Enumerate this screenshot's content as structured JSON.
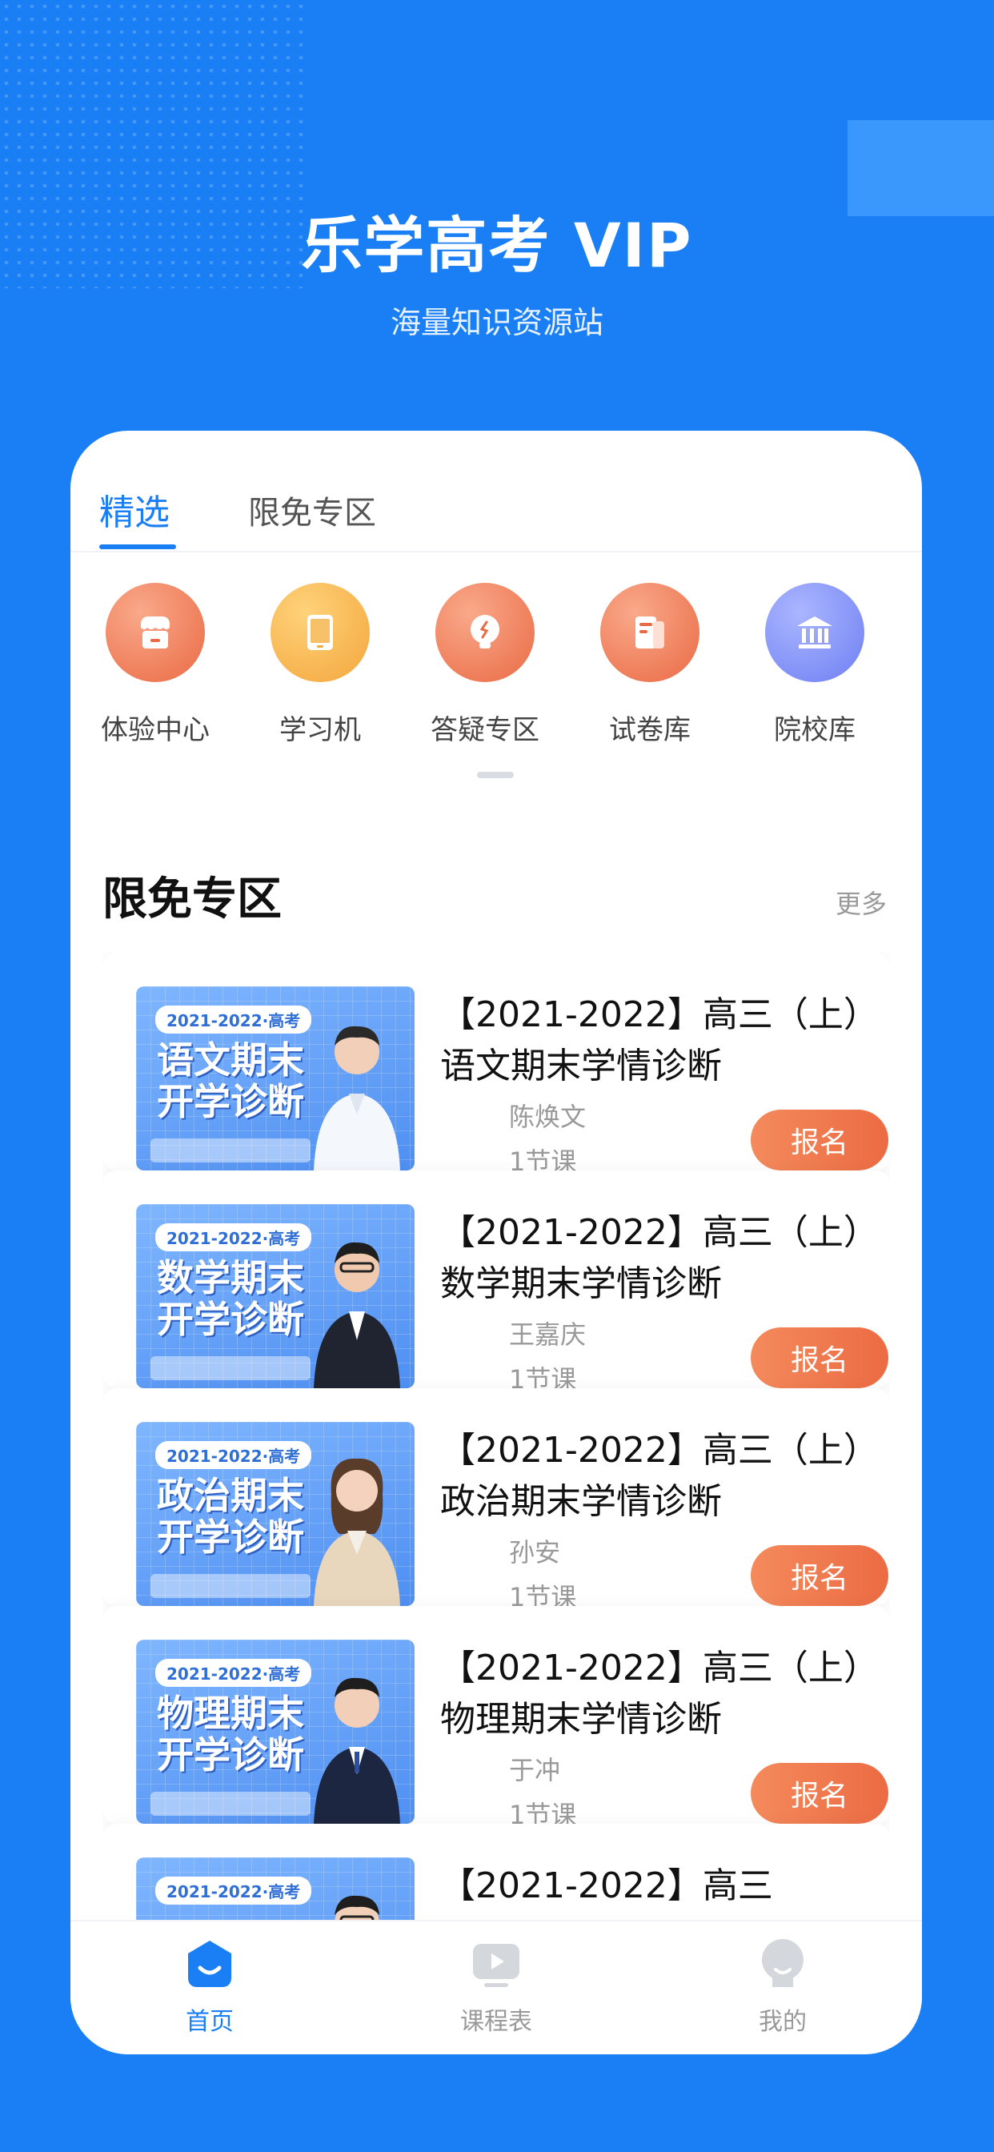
{
  "header": {
    "title": "乐学高考 VIP",
    "subtitle": "海量知识资源站"
  },
  "tabs": [
    {
      "label": "精选",
      "active": true
    },
    {
      "label": "限免专区",
      "active": false
    }
  ],
  "categories": [
    {
      "label": "体验中心",
      "icon": "shop-icon",
      "color": "#f07a5a"
    },
    {
      "label": "学习机",
      "icon": "tablet-icon",
      "color": "#f7b24a"
    },
    {
      "label": "答疑专区",
      "icon": "lightbulb-icon",
      "color": "#f07a5a"
    },
    {
      "label": "试卷库",
      "icon": "document-icon",
      "color": "#f07a5a"
    },
    {
      "label": "院校库",
      "icon": "institution-icon",
      "color": "#7f8ff7"
    }
  ],
  "section": {
    "title": "限免专区",
    "more_label": "更多"
  },
  "courses": [
    {
      "badge": "2021-2022·高考",
      "cover_text": "语文期末\n开学诊断",
      "title": "【2021-2022】高三（上）语文期末学情诊断",
      "teacher": "陈焕文",
      "lessons": "1节课",
      "enroll_label": "报名"
    },
    {
      "badge": "2021-2022·高考",
      "cover_text": "数学期末\n开学诊断",
      "title": "【2021-2022】高三（上）数学期末学情诊断",
      "teacher": "王嘉庆",
      "lessons": "1节课",
      "enroll_label": "报名"
    },
    {
      "badge": "2021-2022·高考",
      "cover_text": "政治期末\n开学诊断",
      "title": "【2021-2022】高三（上）政治期末学情诊断",
      "teacher": "孙安",
      "lessons": "1节课",
      "enroll_label": "报名"
    },
    {
      "badge": "2021-2022·高考",
      "cover_text": "物理期末\n开学诊断",
      "title": "【2021-2022】高三（上）物理期末学情诊断",
      "teacher": "于冲",
      "lessons": "1节课",
      "enroll_label": "报名"
    },
    {
      "badge": "2021-2022·高考",
      "cover_text": "",
      "title": "【2021-2022】高三",
      "teacher": "",
      "lessons": "",
      "enroll_label": ""
    }
  ],
  "bottom_nav": [
    {
      "label": "首页",
      "icon": "home-icon",
      "active": true
    },
    {
      "label": "课程表",
      "icon": "play-icon",
      "active": false
    },
    {
      "label": "我的",
      "icon": "profile-icon",
      "active": false
    }
  ],
  "colors": {
    "brand": "#1a7ff5",
    "accent": "#ec6b43"
  }
}
